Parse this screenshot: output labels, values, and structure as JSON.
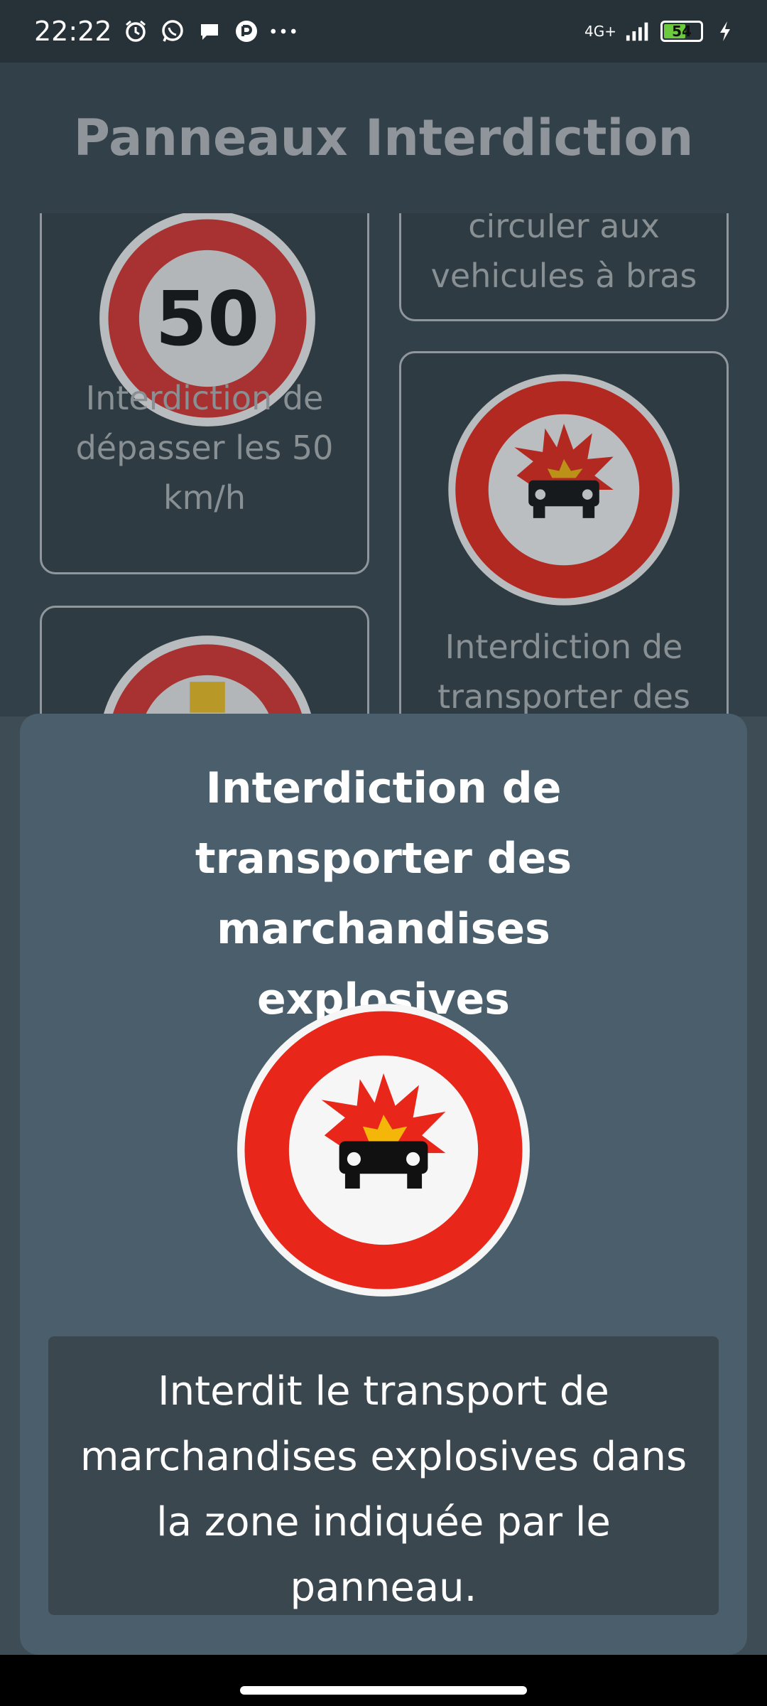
{
  "status_bar": {
    "time": "22:22",
    "network": "4G+",
    "battery": "54",
    "icons": [
      "alarm-icon",
      "whatsapp-icon",
      "message-icon",
      "app-icon",
      "more-icon",
      "signal-icon",
      "battery-icon",
      "charging-icon"
    ]
  },
  "app_bar": {
    "title": "Panneaux Interdiction"
  },
  "grid": {
    "cards": [
      {
        "label": "Interdiction de dépasser les 50 km/h",
        "sign": "50"
      },
      {
        "label": "circuler aux vehicules à bras"
      },
      {
        "label": "Interdiction de transporter des"
      },
      {
        "label": ""
      }
    ]
  },
  "sheet": {
    "title": "Interdiction de transporter des marchandises explosives",
    "description": "Interdit le transport de marchandises explosives dans la zone indiquée par le panneau."
  },
  "colors": {
    "sign_red": "#e8261a",
    "sheet_bg": "#4a5f6b",
    "desc_bg": "#3a474f"
  }
}
